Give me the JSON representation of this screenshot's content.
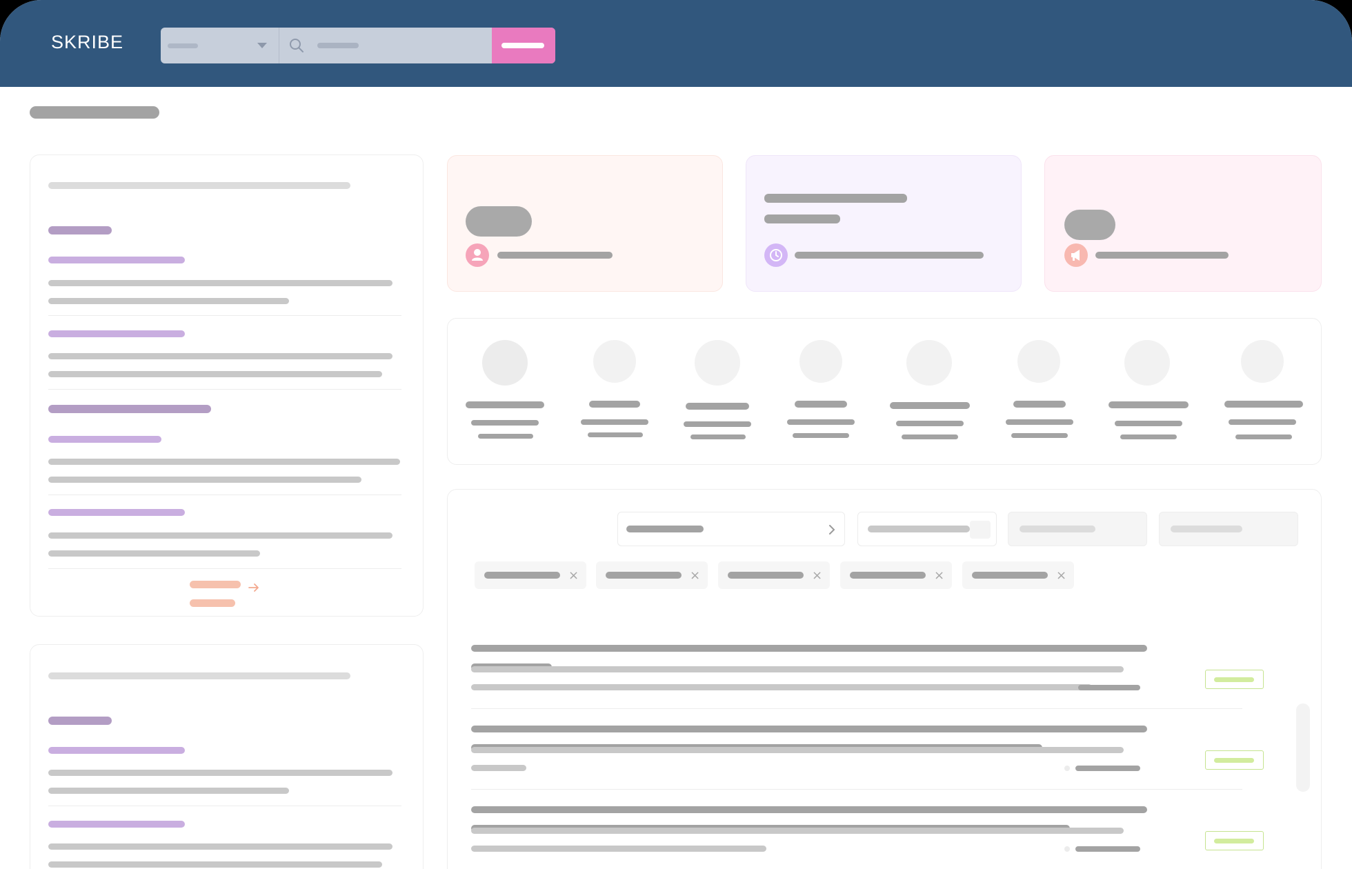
{
  "app": {
    "logo_text": "SKRIBE"
  },
  "header": {
    "scope_select": {
      "icon": "chevron-down-icon"
    },
    "search": {
      "icon": "search-icon"
    },
    "search_button": {
      "color": "#e97abf"
    },
    "background": "#31577d"
  },
  "stats": [
    {
      "icon": "user-icon",
      "accent": "#f6a4b9"
    },
    {
      "icon": "clock-icon",
      "accent": "#d3b6f6"
    },
    {
      "icon": "megaphone-icon",
      "accent": "#f8b8b0"
    }
  ],
  "filters": {
    "chips_count": 5,
    "chip_close_glyph": "×"
  },
  "results": {
    "tag_color": "#c5e38f"
  },
  "sidebar": {
    "more_link_icon": "arrow-right-icon",
    "more_link_color": "#f6c1ad"
  }
}
